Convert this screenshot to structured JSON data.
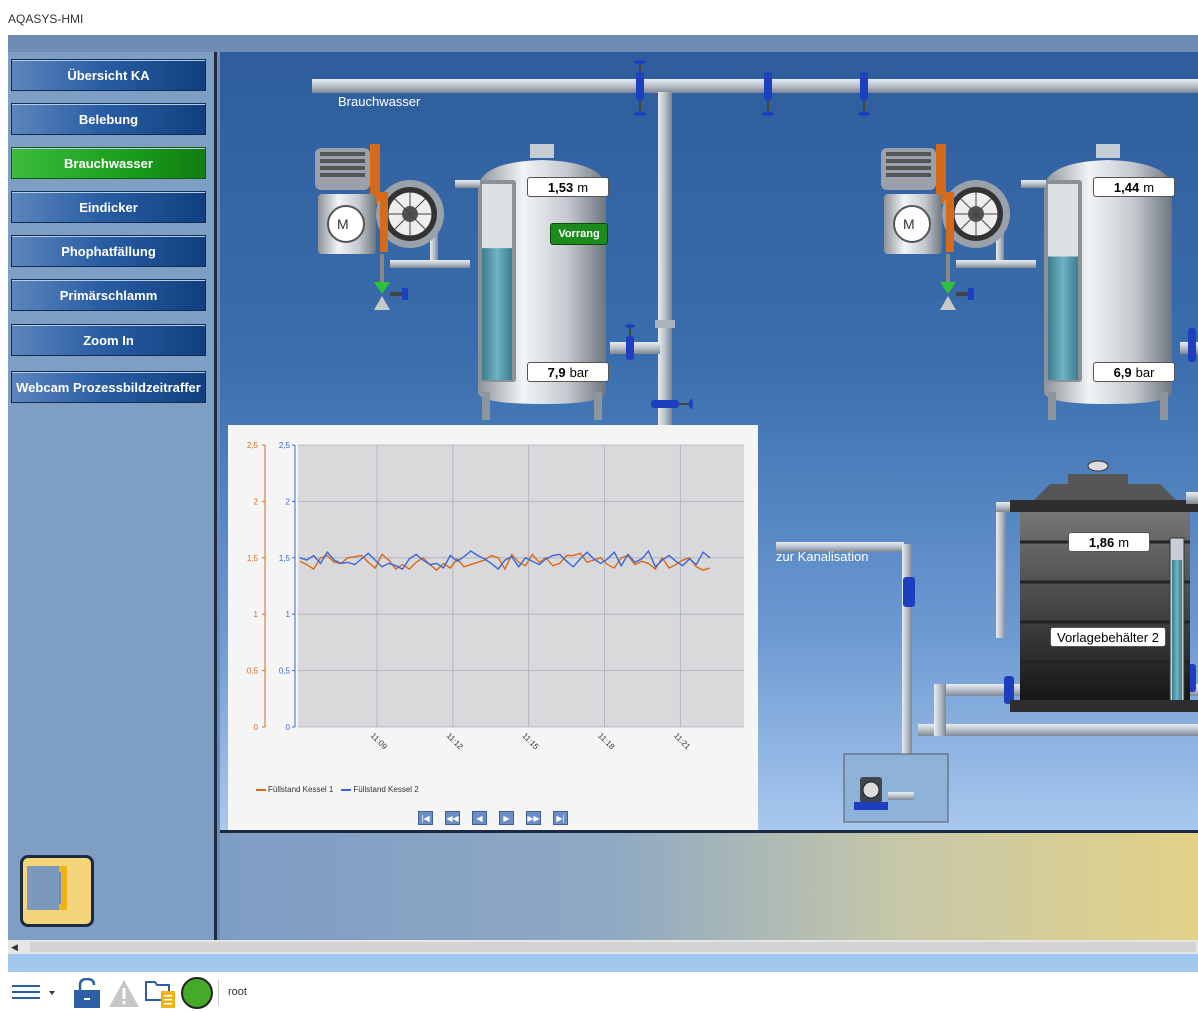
{
  "app": {
    "title": "AQASYS-HMI"
  },
  "nav": {
    "items": [
      {
        "label": "Übersicht KA",
        "active": false
      },
      {
        "label": "Belebung",
        "active": false
      },
      {
        "label": "Brauchwasser",
        "active": true
      },
      {
        "label": "Eindicker",
        "active": false
      },
      {
        "label": "Phophatfällung",
        "active": false
      },
      {
        "label": "Primärschlamm",
        "active": false
      },
      {
        "label": "Zoom In",
        "active": false
      },
      {
        "label": "Webcam Prozessbildzeitraffer",
        "active": false
      }
    ]
  },
  "scene": {
    "pipe_label": "Brauchwasser",
    "outlet_label": "zur Kanalisation",
    "tank1": {
      "level_value": "1,53",
      "level_unit": "m",
      "pressure_value": "7,9",
      "pressure_unit": "bar",
      "badge": "Vorrang",
      "fill_fraction": 0.58
    },
    "tank2": {
      "level_value": "1,44",
      "level_unit": "m",
      "pressure_value": "6,9",
      "pressure_unit": "bar",
      "fill_fraction": 0.6
    },
    "tank3": {
      "level_value": "1,86",
      "level_unit": "m",
      "name": "Vorlagebehälter 2"
    },
    "motor_label": "M"
  },
  "chart_data": {
    "type": "line",
    "x": [
      "11:09",
      "11:12",
      "11:15",
      "11:18",
      "11:21"
    ],
    "ylim": [
      0,
      2.5
    ],
    "yticks": [
      "0",
      "0,5",
      "1",
      "1,5",
      "2",
      "2,5"
    ],
    "series": [
      {
        "name": "Füllstand Kessel 1",
        "color": "#d86a1a",
        "values": [
          1.47,
          1.44,
          1.4,
          1.5,
          1.52,
          1.46,
          1.45,
          1.5,
          1.51,
          1.52,
          1.46,
          1.41,
          1.53,
          1.48,
          1.4,
          1.44,
          1.4,
          1.46,
          1.5,
          1.44,
          1.39,
          1.45,
          1.41,
          1.49,
          1.42,
          1.44,
          1.46,
          1.48,
          1.52,
          1.5,
          1.4,
          1.53,
          1.46,
          1.43,
          1.53,
          1.46,
          1.5,
          1.43,
          1.45,
          1.52,
          1.52,
          1.54,
          1.46,
          1.48,
          1.5,
          1.44,
          1.41,
          1.5,
          1.52,
          1.44,
          1.47,
          1.45,
          1.4,
          1.5,
          1.41,
          1.44,
          1.48,
          1.5,
          1.42,
          1.39,
          1.41
        ]
      },
      {
        "name": "Füllstand Kessel  2",
        "color": "#3b66d6",
        "values": [
          1.5,
          1.48,
          1.52,
          1.45,
          1.55,
          1.48,
          1.45,
          1.46,
          1.44,
          1.49,
          1.54,
          1.48,
          1.42,
          1.45,
          1.43,
          1.4,
          1.49,
          1.53,
          1.48,
          1.44,
          1.45,
          1.41,
          1.52,
          1.47,
          1.51,
          1.56,
          1.52,
          1.49,
          1.45,
          1.4,
          1.48,
          1.51,
          1.42,
          1.5,
          1.47,
          1.44,
          1.49,
          1.52,
          1.53,
          1.47,
          1.42,
          1.49,
          1.55,
          1.49,
          1.45,
          1.49,
          1.55,
          1.43,
          1.53,
          1.46,
          1.49,
          1.56,
          1.42,
          1.48,
          1.52,
          1.47,
          1.43,
          1.49,
          1.44,
          1.55,
          1.5
        ]
      }
    ],
    "grid": true,
    "legend": "bottom-left"
  },
  "statusbar": {
    "user": "root"
  },
  "colors": {
    "accent": "#1b9e1b",
    "nav": "#2a5ea4",
    "scene_bg": "#3a6eae"
  }
}
